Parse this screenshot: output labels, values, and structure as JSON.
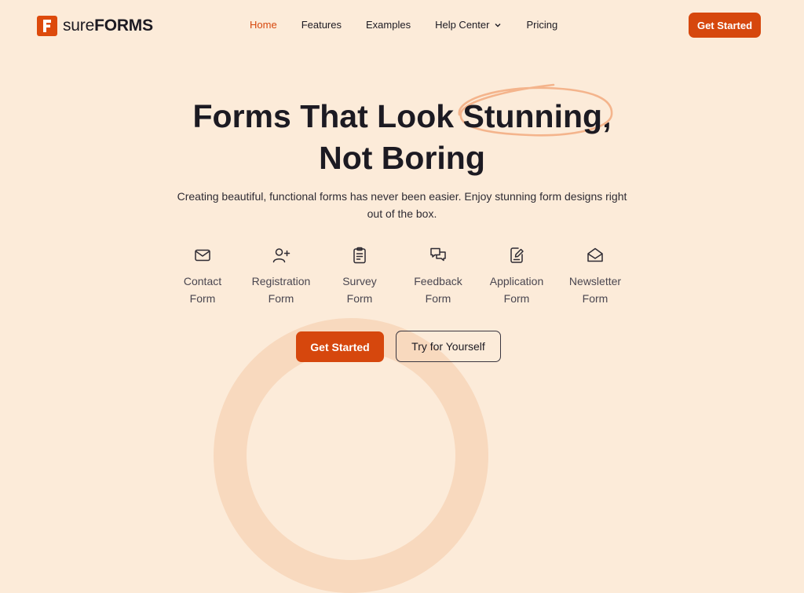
{
  "brand": {
    "prefix": "sure",
    "suffix": "FORMS",
    "accent": "#d6470d"
  },
  "nav": {
    "items": [
      {
        "label": "Home",
        "active": true
      },
      {
        "label": "Features"
      },
      {
        "label": "Examples"
      },
      {
        "label": "Help Center",
        "has_dropdown": true
      },
      {
        "label": "Pricing"
      }
    ],
    "cta_label": "Get Started"
  },
  "hero": {
    "title_part1": "Forms That Look ",
    "title_highlight": "Stunning",
    "title_part2": ",",
    "title_line2": "Not Boring",
    "subtitle_line1": "Creating beautiful, functional forms has never been easier. Enjoy stunning form designs right",
    "subtitle_line2": "out of the box."
  },
  "form_types": [
    {
      "icon": "mail-icon",
      "line1": "Contact",
      "line2": "Form"
    },
    {
      "icon": "user-plus-icon",
      "line1": "Registration",
      "line2": "Form"
    },
    {
      "icon": "clipboard-icon",
      "line1": "Survey",
      "line2": "Form"
    },
    {
      "icon": "chat-bubbles-icon",
      "line1": "Feedback",
      "line2": "Form"
    },
    {
      "icon": "document-edit-icon",
      "line1": "Application",
      "line2": "Form"
    },
    {
      "icon": "envelope-open-icon",
      "line1": "Newsletter",
      "line2": "Form"
    }
  ],
  "actions": {
    "primary_label": "Get Started",
    "secondary_label": "Try for Yourself"
  }
}
